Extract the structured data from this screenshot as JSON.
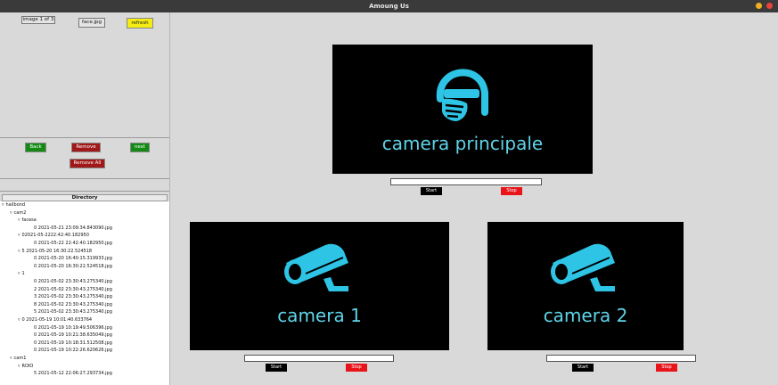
{
  "window": {
    "title": "Amoung Us"
  },
  "image_viewer": {
    "image_index": "image 1 of 3",
    "file_name": "face.jpg",
    "refresh_label": "refresh"
  },
  "actions": {
    "back_label": "Back",
    "remove_label": "Remove",
    "next_label": "next",
    "remove_all_label": "Remove All"
  },
  "directory": {
    "header": "Directory",
    "rows": [
      {
        "indent": 0,
        "toggle": "▿",
        "text": "hailbond"
      },
      {
        "indent": 1,
        "toggle": "▿",
        "text": "cam2"
      },
      {
        "indent": 2,
        "toggle": "▿",
        "text": "facesa"
      },
      {
        "indent": 4,
        "toggle": "",
        "text": "0 2021-05-21 23:09:34.843090.jpg"
      },
      {
        "indent": 2,
        "toggle": "▿",
        "text": "02021-05-2222:42:40.182950"
      },
      {
        "indent": 4,
        "toggle": "",
        "text": "0 2021-05-22 22:42:40.182950.jpg"
      },
      {
        "indent": 2,
        "toggle": "▿",
        "text": "5 2021-05-20 16:30:22.524518"
      },
      {
        "indent": 4,
        "toggle": "",
        "text": "0 2021-05-20 16:40:15.319933.jpg"
      },
      {
        "indent": 4,
        "toggle": "",
        "text": "0 2021-05-20 16:30:22.524518.jpg"
      },
      {
        "indent": 2,
        "toggle": "▿",
        "text": "1"
      },
      {
        "indent": 4,
        "toggle": "",
        "text": "0 2021-05-02 23:30:43.275340.jpg"
      },
      {
        "indent": 4,
        "toggle": "",
        "text": "2 2021-05-02 23:30:43.275340.jpg"
      },
      {
        "indent": 4,
        "toggle": "",
        "text": "3 2021-05-02 23:30:43.275340.jpg"
      },
      {
        "indent": 4,
        "toggle": "",
        "text": "8 2021-05-02 23:30:43.275340.jpg"
      },
      {
        "indent": 4,
        "toggle": "",
        "text": "5 2021-05-02 23:30:43.275340.jpg"
      },
      {
        "indent": 2,
        "toggle": "▿",
        "text": "0 2021-05-19 10:01:40.633764"
      },
      {
        "indent": 4,
        "toggle": "",
        "text": "0 2021-05-19 10:19:49.506396.jpg"
      },
      {
        "indent": 4,
        "toggle": "",
        "text": "0 2021-05-19 10:21:38.635049.jpg"
      },
      {
        "indent": 4,
        "toggle": "",
        "text": "0 2021-05-19 10:18:31.512508.jpg"
      },
      {
        "indent": 4,
        "toggle": "",
        "text": "0 2021-05-19 10:22:26.620626.jpg"
      },
      {
        "indent": 1,
        "toggle": "▿",
        "text": "cam1"
      },
      {
        "indent": 2,
        "toggle": "▿",
        "text": "ROIO"
      },
      {
        "indent": 4,
        "toggle": "",
        "text": "5 2021-05-12 22:06:27.293734.jpg"
      }
    ]
  },
  "cameras": {
    "main": {
      "label": "camera principale",
      "start_label": "Start",
      "stop_label": "Stop",
      "input_value": ""
    },
    "cam1": {
      "label": "camera 1",
      "start_label": "Start",
      "stop_label": "Stop",
      "input_value": ""
    },
    "cam2": {
      "label": "camera 2",
      "start_label": "Start",
      "stop_label": "Stop",
      "input_value": ""
    }
  },
  "colors": {
    "accent_cyan": "#2ec4e6",
    "stop_red": "#e8141a",
    "back_green": "#138a13",
    "remove_red": "#a01818",
    "refresh_yellow": "#f4ec12"
  },
  "icons": {
    "main_camera": "masked-face-icon",
    "cam1": "security-camera-icon",
    "cam2": "security-camera-icon",
    "tree_toggle": "disclosure-triangle-icon"
  }
}
